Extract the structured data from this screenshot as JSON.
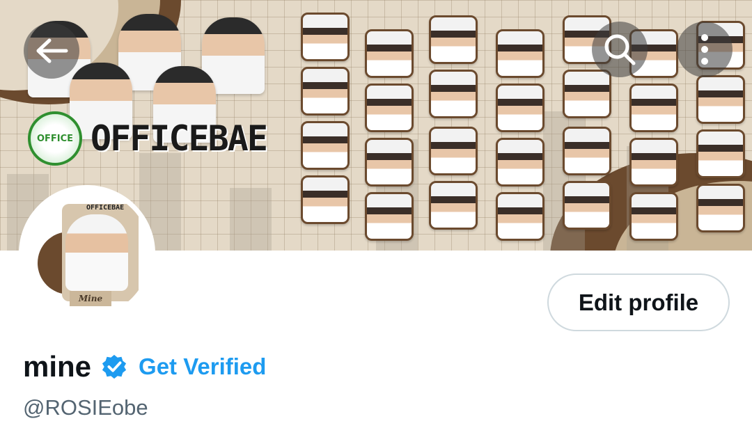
{
  "header": {
    "banner_brand": "OFFICEBAE",
    "banner_logo_text": "OFFICE",
    "icons": {
      "back": "back-arrow-icon",
      "search": "search-icon",
      "more": "more-vertical-icon"
    }
  },
  "profile": {
    "avatar_caption": "Mine",
    "avatar_wordmark": "OFFICEBAE",
    "edit_button_label": "Edit profile",
    "display_name": "mine",
    "verified_icon": "verified-badge-icon",
    "get_verified_label": "Get Verified",
    "handle": "@ROSIEobe"
  },
  "colors": {
    "link_blue": "#1d9bf0",
    "text_primary": "#0f1419",
    "text_secondary": "#536471",
    "button_border": "#cfd9de",
    "banner_brown": "#6b4a2e",
    "banner_beige": "#e4d9c7"
  }
}
